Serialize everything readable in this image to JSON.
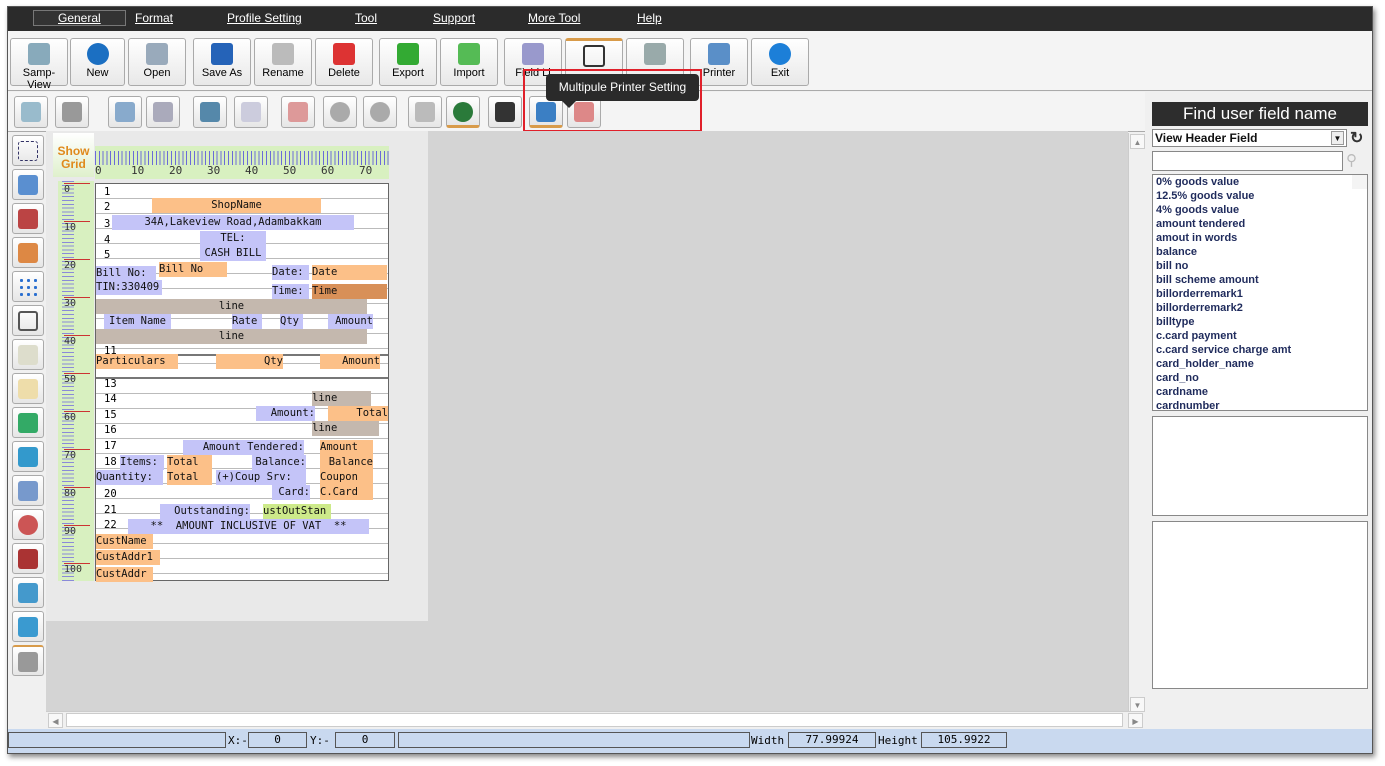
{
  "menu": [
    "General",
    "Format",
    "Profile Setting",
    "Tool",
    "Support",
    "More Tool",
    "Help"
  ],
  "toolbar": [
    "Samp-View",
    "New",
    "Open",
    "Save As",
    "Rename",
    "Delete",
    "Export",
    "Import",
    "Field Li",
    "",
    "",
    "Printer",
    "Exit"
  ],
  "tooltip": "Multipule Printer Setting",
  "show_grid": [
    "Show",
    "Grid"
  ],
  "hruler": [
    "0",
    "10",
    "20",
    "30",
    "40",
    "50",
    "60",
    "70"
  ],
  "vruler": [
    "0",
    "10",
    "20",
    "30",
    "40",
    "50",
    "60",
    "70",
    "80",
    "90",
    "100"
  ],
  "rows": [
    "1",
    "2",
    "3",
    "4",
    "5",
    "11",
    "13",
    "14",
    "15",
    "16",
    "17",
    "18",
    "20",
    "21",
    "22"
  ],
  "fields": {
    "shopname": "ShopName",
    "address": "34A,Lakeview Road,Adambakkam",
    "tel": "TEL:",
    "cashbill": "CASH BILL",
    "billno_label": "Bill No:",
    "billno": "Bill No",
    "date_label": "Date:",
    "date": "Date",
    "tin": "TIN:330409",
    "time_label": "Time:",
    "time": "Time",
    "line1": "line",
    "itemname": "Item Name",
    "rate": "Rate",
    "qty": "Qty",
    "amount": "Amount",
    "line2": "line",
    "particulars": "Particulars",
    "pqty": "Qty",
    "pamount": "Amount",
    "line3": "line",
    "amount_label": "Amount:",
    "total": "Total",
    "line4": "line",
    "tendered_label": "Amount Tendered:",
    "tendered": "Amount",
    "items_label": "Items:",
    "items_total": "Total",
    "balance_label": "Balance:",
    "balance": "Balance",
    "quantity_label": "Quantity:",
    "quantity_total": "Total",
    "coup_label": "(+)Coup Srv:",
    "coupon": "Coupon",
    "card_label": "Card:",
    "card": "C.Card",
    "outstanding_label": "Outstanding:",
    "outstanding": "ustOutStan",
    "vat": "**  AMOUNT INCLUSIVE OF VAT  **",
    "custname": "CustName",
    "custaddr1": "CustAddr1",
    "custaddr": "CustAddr"
  },
  "right_panel": {
    "title": "Find user field name",
    "select": "View Header Field",
    "search_value": "",
    "items": [
      "0% goods value",
      "12.5% goods value",
      "4% goods value",
      "amount tendered",
      "amout in words",
      "balance",
      "bill no",
      "bill scheme amount",
      "billorderremark1",
      "billorderremark2",
      "billtype",
      "c.card payment",
      "c.card service charge amt",
      "card_holder_name",
      "card_no",
      "cardname",
      "cardnumber"
    ]
  },
  "status": {
    "x_label": "X:-",
    "x": "0",
    "y_label": "Y:-",
    "y": "0",
    "width_label": "Width",
    "width": "77.99924",
    "height_label": "Height",
    "height": "105.9922"
  },
  "colors": {
    "label_blue": "#c4c4f8",
    "field_orange": "#fcc088",
    "line_gray": "#c4b8ae",
    "highlight_red": "#e0202a"
  }
}
